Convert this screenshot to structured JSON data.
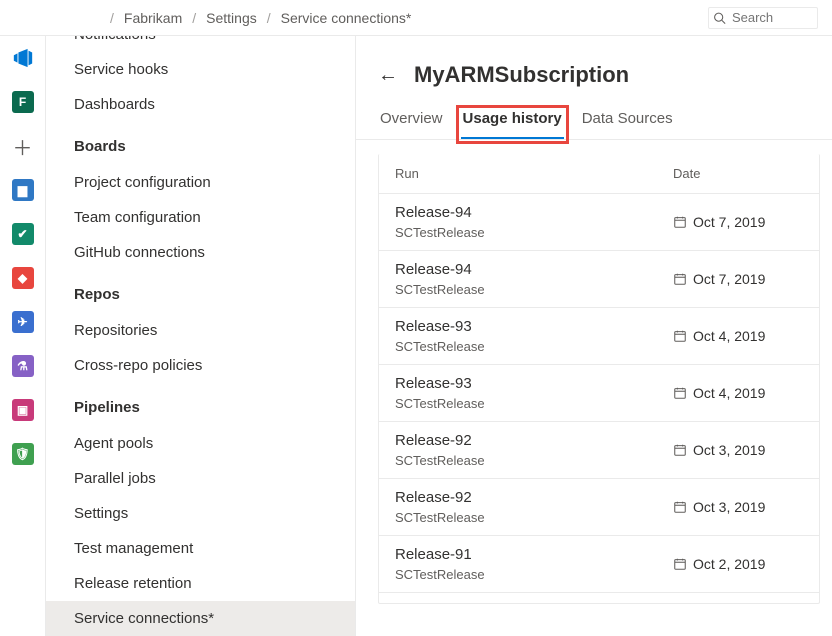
{
  "breadcrumb": {
    "l1": "Fabrikam",
    "l2": "Settings",
    "l3": "Service connections*"
  },
  "search": {
    "placeholder": "Search"
  },
  "rail": {
    "project_initial": "F"
  },
  "sidebar": {
    "groups": [
      {
        "items": [
          {
            "label": "Notifications"
          },
          {
            "label": "Service hooks"
          },
          {
            "label": "Dashboards"
          }
        ]
      },
      {
        "header": "Boards",
        "items": [
          {
            "label": "Project configuration"
          },
          {
            "label": "Team configuration"
          },
          {
            "label": "GitHub connections"
          }
        ]
      },
      {
        "header": "Repos",
        "items": [
          {
            "label": "Repositories"
          },
          {
            "label": "Cross-repo policies"
          }
        ]
      },
      {
        "header": "Pipelines",
        "items": [
          {
            "label": "Agent pools"
          },
          {
            "label": "Parallel jobs"
          },
          {
            "label": "Settings"
          },
          {
            "label": "Test management"
          },
          {
            "label": "Release retention"
          },
          {
            "label": "Service connections*",
            "selected": true
          }
        ]
      }
    ]
  },
  "main": {
    "title": "MyARMSubscription",
    "tabs": [
      {
        "label": "Overview"
      },
      {
        "label": "Usage history",
        "active": true,
        "highlighted": true
      },
      {
        "label": "Data Sources"
      }
    ],
    "columns": {
      "run": "Run",
      "date": "Date"
    },
    "rows": [
      {
        "name": "Release-94",
        "sub": "SCTestRelease",
        "date": "Oct 7, 2019"
      },
      {
        "name": "Release-94",
        "sub": "SCTestRelease",
        "date": "Oct 7, 2019"
      },
      {
        "name": "Release-93",
        "sub": "SCTestRelease",
        "date": "Oct 4, 2019"
      },
      {
        "name": "Release-93",
        "sub": "SCTestRelease",
        "date": "Oct 4, 2019"
      },
      {
        "name": "Release-92",
        "sub": "SCTestRelease",
        "date": "Oct 3, 2019"
      },
      {
        "name": "Release-92",
        "sub": "SCTestRelease",
        "date": "Oct 3, 2019"
      },
      {
        "name": "Release-91",
        "sub": "SCTestRelease",
        "date": "Oct 2, 2019"
      }
    ]
  }
}
